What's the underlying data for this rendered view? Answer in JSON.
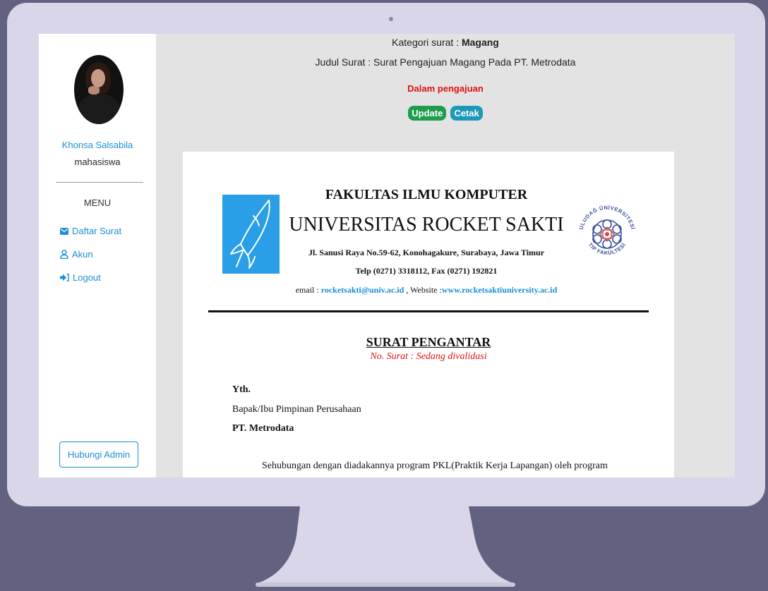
{
  "sidebar": {
    "user_name": "Khonsa Salsabila",
    "user_role": "mahasiswa",
    "menu_title": "MENU",
    "items": [
      {
        "label": "Daftar Surat",
        "icon": "envelope-icon"
      },
      {
        "label": "Akun",
        "icon": "user-icon"
      },
      {
        "label": "Logout",
        "icon": "logout-icon"
      }
    ],
    "admin_button": "Hubungi Admin"
  },
  "header": {
    "kategori_label": "Kategori surat : ",
    "kategori_value": "Magang",
    "judul": "Judul Surat : Surat Pengajuan Magang Pada PT. Metrodata",
    "status": "Dalam pengajuan",
    "update_label": "Update",
    "cetak_label": "Cetak"
  },
  "letter": {
    "fakultas": "FAKULTAS ILMU KOMPUTER",
    "universitas": "UNIVERSITAS ROCKET SAKTI",
    "alamat": "Jl. Sanusi Raya No.59-62, Konohagakure, Surabaya, Jawa Timur",
    "telp": "Telp (0271) 3318112, Fax (0271) 192821",
    "email_label": "email : ",
    "email": "rocketsakti@univ.ac.id",
    "website_label": " , Website :",
    "website": "www.rocketsaktiuniversity.ac.id",
    "title": "SURAT PENGANTAR",
    "nomor": "No. Surat : Sedang divalidasi",
    "yth": "Yth.",
    "tujuan_line1": "Bapak/Ibu Pimpinan Perusahaan",
    "tujuan_line2": "PT. Metrodata",
    "paragraph": "Sehubungan dengan diadakannya program PKL(Praktik Kerja Lapangan) oleh program",
    "seal_text_top": "ULUDAĞ ÜNİVERSİTESİ",
    "seal_text_bottom": "TIP FAKÜLTESİ"
  },
  "colors": {
    "accent": "#1a8fd6",
    "success": "#1f9d4c",
    "info": "#1e98b9",
    "danger": "#e01010",
    "frame": "#d9d6e9",
    "backdrop": "#636180"
  }
}
